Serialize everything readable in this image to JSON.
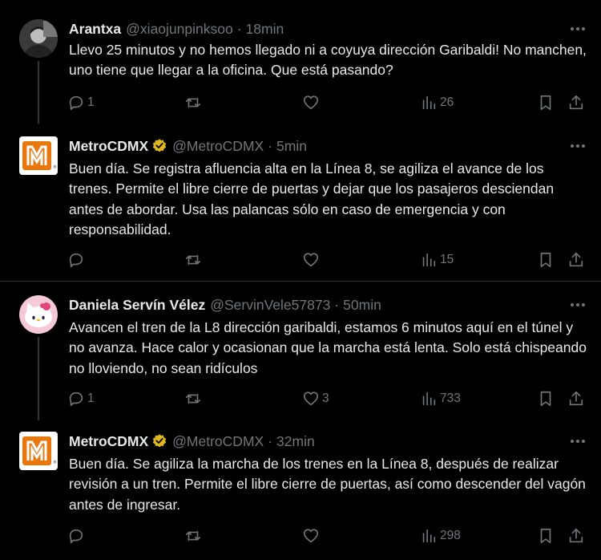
{
  "tweets": [
    {
      "name": "Arantxa",
      "handle": "@xiaojunpinksoo",
      "time": "18min",
      "text": "Llevo 25 minutos y no hemos llegado ni a coyuya dirección Garibaldi! No manchen, uno tiene que llegar a la oficina. Que está pasando?",
      "replies": "1",
      "retweets": "",
      "likes": "",
      "views": "26",
      "avatar_icon": "person-photo"
    },
    {
      "name": "MetroCDMX",
      "handle": "@MetroCDMX",
      "time": "5min",
      "text": "Buen día. Se registra afluencia alta en la Línea 8, se agiliza el avance de los trenes. Permite el libre cierre de puertas y dejar que los pasajeros desciendan antes de abordar. Usa las palancas sólo en caso de emergencia y con responsabilidad.",
      "replies": "",
      "retweets": "",
      "likes": "",
      "views": "15",
      "avatar_icon": "metro-logo",
      "verified": true
    },
    {
      "name": "Daniela Servín Vélez",
      "handle": "@ServinVele57873",
      "time": "50min",
      "text": "Avancen el tren de la L8 dirección garibaldi, estamos 6 minutos aquí en el túnel y no avanza. Hace calor y ocasionan que la marcha está lenta. Solo está chispeando no lloviendo, no sean ridículos",
      "replies": "1",
      "retweets": "",
      "likes": "3",
      "views": "733",
      "avatar_icon": "hello-kitty"
    },
    {
      "name": "MetroCDMX",
      "handle": "@MetroCDMX",
      "time": "32min",
      "text": "Buen día. Se agiliza la marcha de los trenes en la Línea 8, después de realizar revisión a un tren. Permite el libre cierre de puertas, así como descender del vagón antes de ingresar.",
      "replies": "",
      "retweets": "",
      "likes": "",
      "views": "298",
      "avatar_icon": "metro-logo",
      "verified": true
    }
  ],
  "colors": {
    "background": "#000000",
    "text": "#e7e9ea",
    "muted": "#71767b",
    "metro_orange": "#e8780e",
    "verified_gold": "#e2b719"
  },
  "separator": "·"
}
